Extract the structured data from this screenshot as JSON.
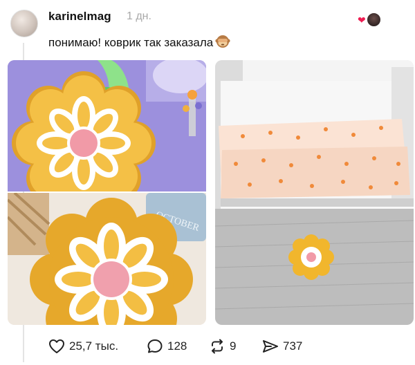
{
  "post": {
    "author": "karinelmag",
    "time": "1 дн.",
    "text": "понимаю! коврик так заказала",
    "emoji": "see-no-evil-monkey"
  },
  "photos": [
    {
      "kind": "yellow-flower-rug-on-purple-floor"
    },
    {
      "kind": "yellow-flower-rug-closeup"
    },
    {
      "kind": "bedroom-with-flower-rug",
      "pillow_text": "OCTOBER"
    }
  ],
  "actions": {
    "likes": "25,7 тыс.",
    "comments": "128",
    "reposts": "9",
    "shares": "737"
  },
  "colors": {
    "accent_heart": "#ee1d52",
    "rug_yellow": "#f2b72c",
    "rug_pink": "#f19aa7",
    "background": "#9d92de"
  }
}
